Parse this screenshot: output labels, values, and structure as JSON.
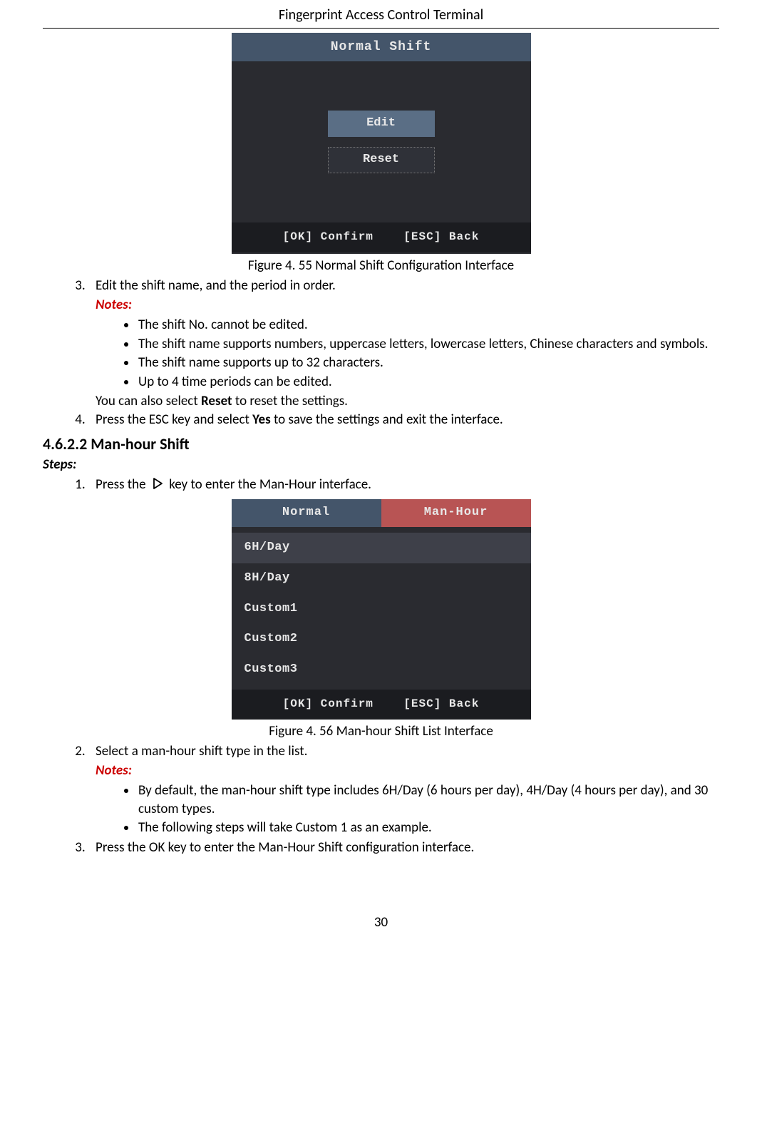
{
  "header": {
    "title": "Fingerprint Access Control Terminal"
  },
  "fig1": {
    "title": "Normal Shift",
    "btn_edit": "Edit",
    "btn_reset": "Reset",
    "footer_ok": "[OK] Confirm",
    "footer_esc": "[ESC] Back",
    "caption": "Figure 4. 55 Normal Shift Configuration Interface"
  },
  "step3": {
    "line": "Edit the shift name, and the period in order.",
    "notes_label": "Notes:",
    "notes": [
      "The shift No. cannot be edited.",
      "The shift name supports numbers, uppercase letters, lowercase letters, Chinese characters and symbols.",
      "The shift name supports up to 32 characters.",
      "Up to 4 time periods can be edited."
    ],
    "reset_pre": "You can also select ",
    "reset_bold": "Reset",
    "reset_post": " to reset the settings."
  },
  "step4": {
    "pre": "Press the ESC key and select ",
    "bold": "Yes",
    "post": " to save the settings and exit the interface."
  },
  "sect": {
    "heading": "4.6.2.2 Man-hour Shift",
    "steps_label": "Steps:"
  },
  "mh_step1": {
    "pre": "Press the",
    "post": "key to enter the Man-Hour interface."
  },
  "fig2": {
    "tab_normal": "Normal",
    "tab_manhour": "Man-Hour",
    "items": [
      "6H/Day",
      "8H/Day",
      "Custom1",
      "Custom2",
      "Custom3"
    ],
    "footer_ok": "[OK] Confirm",
    "footer_esc": "[ESC] Back",
    "caption": "Figure 4. 56 Man-hour Shift List Interface"
  },
  "mh_step2": {
    "line": "Select a man-hour shift type in the list.",
    "notes_label": "Notes:",
    "notes": [
      "By default, the man-hour shift type includes 6H/Day (6 hours per day), 4H/Day (4 hours per day), and 30 custom types.",
      "The following steps will take Custom 1 as an example."
    ]
  },
  "mh_step3": {
    "line": "Press the OK key to enter the Man-Hour Shift configuration interface."
  },
  "page_number": "30"
}
